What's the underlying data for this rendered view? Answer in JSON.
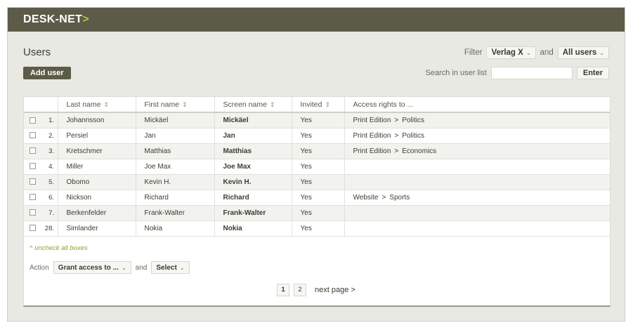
{
  "app": {
    "logo_text": "DESK-NET",
    "logo_arrow": ">"
  },
  "page": {
    "title": "Users",
    "add_user_label": "Add user"
  },
  "filter": {
    "label": "Filter",
    "publication": "Verlag X",
    "and_label": "and",
    "users": "All users"
  },
  "search": {
    "label": "Search in user list",
    "value": "",
    "placeholder": "",
    "enter_label": "Enter"
  },
  "table": {
    "columns": [
      "Last name",
      "First name",
      "Screen name",
      "Invited",
      "Access rights to ..."
    ],
    "rows": [
      {
        "num": "1.",
        "last": "Johannsson",
        "first": "Mickäel",
        "screen": "Mickäel",
        "invited": "Yes",
        "access_a": "Print Edition",
        "access_sep": ">",
        "access_b": "Politics"
      },
      {
        "num": "2.",
        "last": "Persiel",
        "first": "Jan",
        "screen": "Jan",
        "invited": "Yes",
        "access_a": "Print Edition",
        "access_sep": ">",
        "access_b": "Politics"
      },
      {
        "num": "3.",
        "last": "Kretschmer",
        "first": "Matthias",
        "screen": "Matthias",
        "invited": "Yes",
        "access_a": "Print Edition",
        "access_sep": ">",
        "access_b": "Economics"
      },
      {
        "num": "4.",
        "last": "Miller",
        "first": "Joe Max",
        "screen": "Joe Max",
        "invited": "Yes",
        "access_a": "",
        "access_sep": "",
        "access_b": ""
      },
      {
        "num": "5.",
        "last": "Obomo",
        "first": "Kevin H.",
        "screen": "Kevin H.",
        "invited": "Yes",
        "access_a": "",
        "access_sep": "",
        "access_b": ""
      },
      {
        "num": "6.",
        "last": "Nickson",
        "first": "Richard",
        "screen": "Richard",
        "invited": "Yes",
        "access_a": "Website",
        "access_sep": ">",
        "access_b": "Sports"
      },
      {
        "num": "7.",
        "last": "Berkenfelder",
        "first": "Frank-Walter",
        "screen": "Frank-Walter",
        "invited": "Yes",
        "access_a": "",
        "access_sep": "",
        "access_b": ""
      },
      {
        "num": "28.",
        "last": "Simlander",
        "first": "Nokia",
        "screen": "Nokia",
        "invited": "Yes",
        "access_a": "",
        "access_sep": "",
        "access_b": ""
      }
    ]
  },
  "bulk": {
    "uncheck_label": "^ uncheck all boxes",
    "action_label": "Action",
    "action_value": "Grant access to ...",
    "and_label": "and",
    "select_value": "Select"
  },
  "pagination": {
    "page_1": "1",
    "page_2": "2",
    "next_label": "next page >"
  },
  "icons": {
    "sort": "sort-arrows-icon",
    "chevron": "chevron-down-icon",
    "checkbox": "checkbox-icon"
  },
  "colors": {
    "topbar": "#5b5b48",
    "accent": "#b6c23a",
    "link": "#8fa02a",
    "background": "#e9e9e3"
  }
}
